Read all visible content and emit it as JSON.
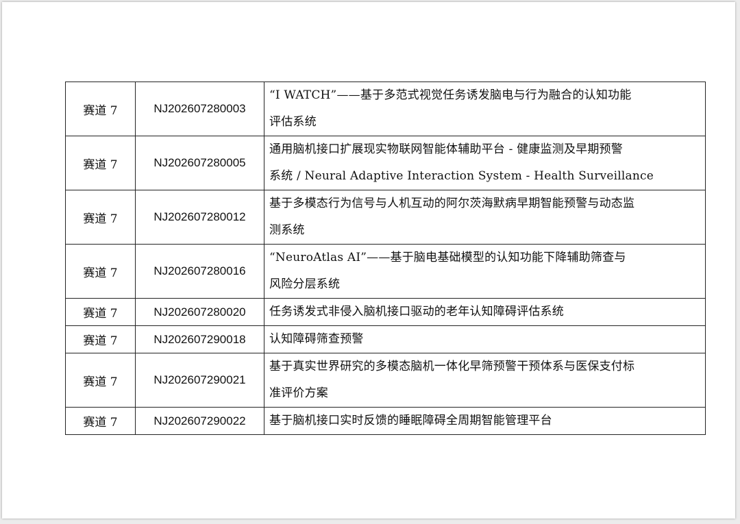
{
  "rows": [
    {
      "track": "赛道 7",
      "code": "NJ202607280003",
      "title_lines": [
        "“I WATCH”——基于多范式视觉任务诱发脑电与行为融合的认知功能",
        "评估系统"
      ]
    },
    {
      "track": "赛道 7",
      "code": "NJ202607280005",
      "title_lines": [
        "通用脑机接口扩展现实物联网智能体辅助平台 - 健康监测及早期预警",
        "系统 / Neural Adaptive Interaction System - Health Surveillance"
      ]
    },
    {
      "track": "赛道 7",
      "code": "NJ202607280012",
      "title_lines": [
        "基于多模态行为信号与人机互动的阿尔茨海默病早期智能预警与动态监",
        "测系统"
      ]
    },
    {
      "track": "赛道 7",
      "code": "NJ202607280016",
      "title_lines": [
        "“NeuroAtlas AI”——基于脑电基础模型的认知功能下降辅助筛查与",
        "风险分层系统"
      ]
    },
    {
      "track": "赛道 7",
      "code": "NJ202607280020",
      "title_lines": [
        "任务诱发式非侵入脑机接口驱动的老年认知障碍评估系统"
      ]
    },
    {
      "track": "赛道 7",
      "code": "NJ202607290018",
      "title_lines": [
        "认知障碍筛查预警"
      ]
    },
    {
      "track": "赛道 7",
      "code": "NJ202607290021",
      "title_lines": [
        "基于真实世界研究的多模态脑机一体化早筛预警干预体系与医保支付标",
        "准评价方案"
      ]
    },
    {
      "track": "赛道 7",
      "code": "NJ202607290022",
      "title_lines": [
        "基于脑机接口实时反馈的睡眠障碍全周期智能管理平台"
      ]
    }
  ]
}
